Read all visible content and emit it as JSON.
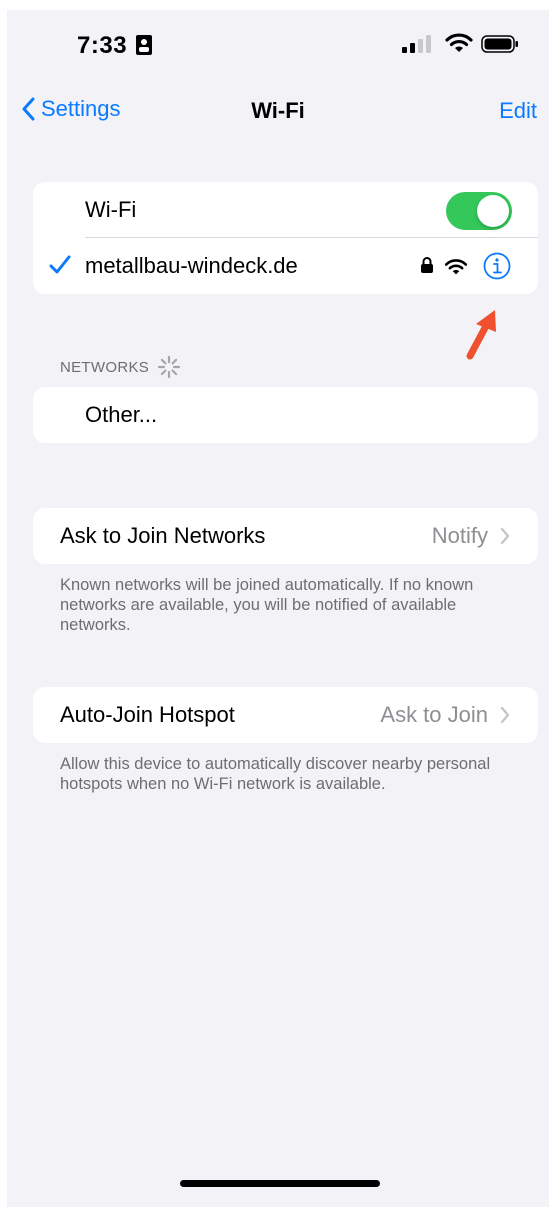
{
  "status_bar": {
    "time": "7:33"
  },
  "nav": {
    "back_label": "Settings",
    "title": "Wi-Fi",
    "edit_label": "Edit"
  },
  "wifi_group": {
    "toggle_label": "Wi-Fi",
    "toggle_on": true,
    "connected_network": "metallbau-windeck.de"
  },
  "networks_section": {
    "header": "NETWORKS",
    "other_label": "Other..."
  },
  "ask_to_join": {
    "label": "Ask to Join Networks",
    "value": "Notify",
    "footer": "Known networks will be joined automatically. If no known networks are available, you will be notified of available networks."
  },
  "auto_join_hotspot": {
    "label": "Auto-Join Hotspot",
    "value": "Ask to Join",
    "footer": "Allow this device to automatically discover nearby personal hotspots when no Wi-Fi network is available."
  },
  "colors": {
    "accent": "#0a7aff",
    "toggle_on": "#34c759",
    "background": "#f2f2f7",
    "annotation_arrow": "#f0502e"
  },
  "icons": [
    "id-card-icon",
    "cellular-signal-icon",
    "wifi-icon",
    "battery-icon",
    "chevron-left-icon",
    "checkmark-icon",
    "lock-icon",
    "info-icon",
    "spinner-icon",
    "chevron-right-icon",
    "arrow-annotation"
  ]
}
